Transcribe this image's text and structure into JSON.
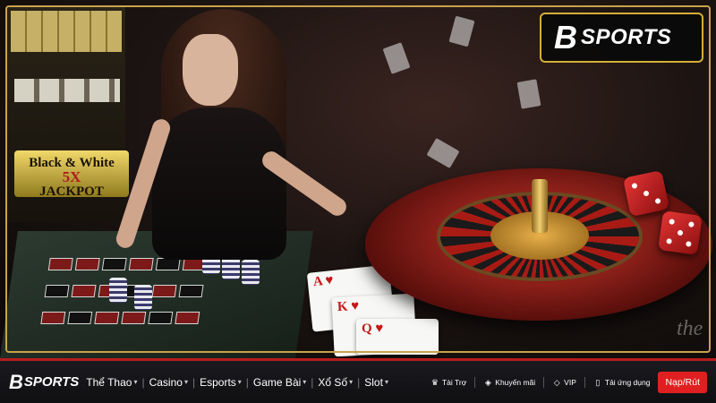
{
  "hero": {
    "slot_jackpot_line1": "Black & White",
    "slot_jackpot_line2": "5X",
    "slot_jackpot_line3": "JACKPOT",
    "watermark": "the",
    "cards": [
      "A ♥",
      "K ♥",
      "Q ♥"
    ]
  },
  "badge": {
    "mark": "B",
    "text": "SPORTS"
  },
  "nav": {
    "logo_mark": "B",
    "logo_text": "SPORTS",
    "menu": [
      {
        "label": "Thể Thao"
      },
      {
        "label": "Casino"
      },
      {
        "label": "Esports"
      },
      {
        "label": "Game Bài"
      },
      {
        "label": "Xổ Số"
      },
      {
        "label": "Slot"
      }
    ],
    "caret": "▾",
    "separator": "|",
    "utilities": [
      {
        "icon": "sponsor-icon",
        "glyph": "♛",
        "label": "Tài Trợ"
      },
      {
        "icon": "tag-icon",
        "glyph": "◈",
        "label": "Khuyến mãi"
      },
      {
        "icon": "diamond-icon",
        "glyph": "◇",
        "label": "VIP"
      },
      {
        "icon": "phone-icon",
        "glyph": "▯",
        "label": "Tải ứng dụng"
      }
    ],
    "cta_label": "Nạp/Rút"
  },
  "colors": {
    "accent_red": "#e02020",
    "gold_border": "#d4af37",
    "nav_bg": "#141417"
  }
}
